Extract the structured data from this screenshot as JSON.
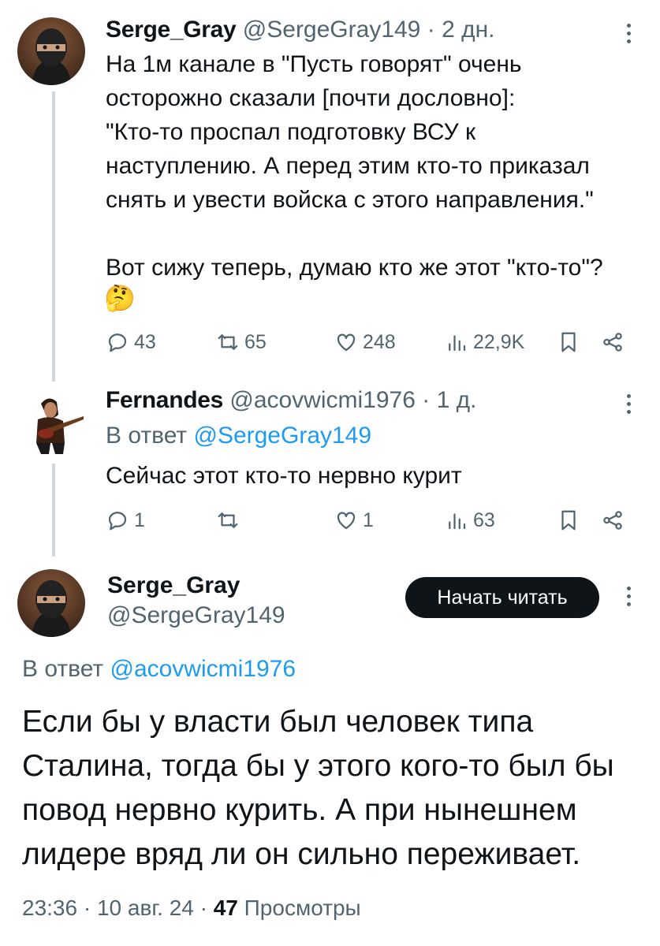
{
  "tweets": [
    {
      "name": "Serge_Gray",
      "handle": "@SergeGray149",
      "sep": "·",
      "time": "2 дн.",
      "text": "На 1м канале в \"Пусть говорят\" очень\nосторожно сказали [почти дословно]:\n\"Кто-то проспал подготовку ВСУ к\nнаступлению. А перед этим кто-то приказал\nснять и увести войска с этого направления.\"\n\nВот сижу теперь, думаю кто же этот \"кто-то\"?",
      "emoji": "🤔",
      "replies": "43",
      "retweets": "65",
      "likes": "248",
      "views": "22,9K"
    },
    {
      "name": "Fernandes",
      "handle": "@acovwicmi1976",
      "sep": "·",
      "time": "1 д.",
      "reply_prefix": "В ответ",
      "reply_mention": "@SergeGray149",
      "text": "Сейчас этот кто-то нервно курит",
      "replies": "1",
      "retweets": "",
      "likes": "1",
      "views": "63"
    }
  ],
  "main": {
    "name": "Serge_Gray",
    "handle": "@SergeGray149",
    "follow_label": "Начать читать",
    "reply_prefix": "В ответ",
    "reply_mention": "@acovwicmi1976",
    "text": "Если бы у власти был человек типа Сталина, тогда бы у этого кого-то был бы повод нервно курить. А при нынешнем лидере вряд ли он сильно переживает.",
    "time": "23:36",
    "sep1": "·",
    "date": "10 авг. 24",
    "sep2": "·",
    "views_count": "47",
    "views_label": "Просмотры"
  },
  "icons": [
    "reply-icon",
    "retweet-icon",
    "like-icon",
    "views-icon",
    "bookmark-icon",
    "share-icon",
    "more-icon"
  ]
}
